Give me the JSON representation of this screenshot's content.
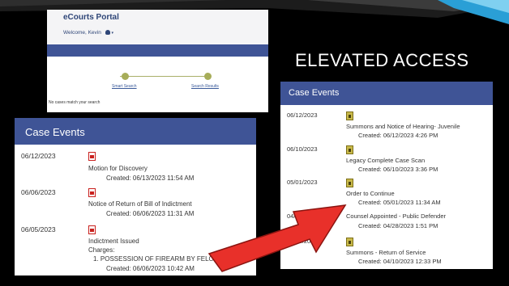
{
  "slide": {
    "title": "ELEVATED ACCESS",
    "accent": "#2a9fd6"
  },
  "portal": {
    "title": "eCourts Portal",
    "welcome": "Welcome, Kevin",
    "steps": [
      "Smart Search",
      "Search Results"
    ],
    "message": "No cases match your search",
    "bar_color": "#3f5496"
  },
  "left_events": {
    "header": "Case Events",
    "icon": "pdf-icon",
    "items": [
      {
        "date": "06/12/2023",
        "title": "Motion for Discovery",
        "created": "Created:    06/13/2023 11:54 AM"
      },
      {
        "date": "06/06/2023",
        "title": "Notice of Return of Bill of Indictment",
        "created": "Created:    06/06/2023 11:31 AM"
      },
      {
        "date": "06/05/2023",
        "title": "Indictment Issued",
        "charges_label": "Charges:",
        "charge": "1. POSSESSION OF FIREARM BY FELON (5224)",
        "created": "Created:    06/06/2023 10:42 AM"
      }
    ]
  },
  "right_events": {
    "header": "Case Events",
    "icon": "lock-icon",
    "items": [
      {
        "date": "06/12/2023",
        "title": "Summons and Notice of Hearing- Juvenile",
        "created": "Created:    06/12/2023 4:26 PM"
      },
      {
        "date": "06/10/2023",
        "title": "Legacy Complete Case Scan",
        "created": "Created:    06/10/2023 3:36 PM"
      },
      {
        "date": "05/01/2023",
        "title": "Order to Continue",
        "created": "Created:    05/01/2023 11:34 AM"
      },
      {
        "date": "04/28/2023",
        "title": "Counsel Appointed - Public Defender",
        "created": "Created:    04/28/2023 1:51 PM"
      },
      {
        "date": "04/10/2023",
        "title": "Summons - Return of Service",
        "created": "Created:    04/10/2023 12:33 PM"
      }
    ]
  },
  "arrow_color": "#e8302a"
}
